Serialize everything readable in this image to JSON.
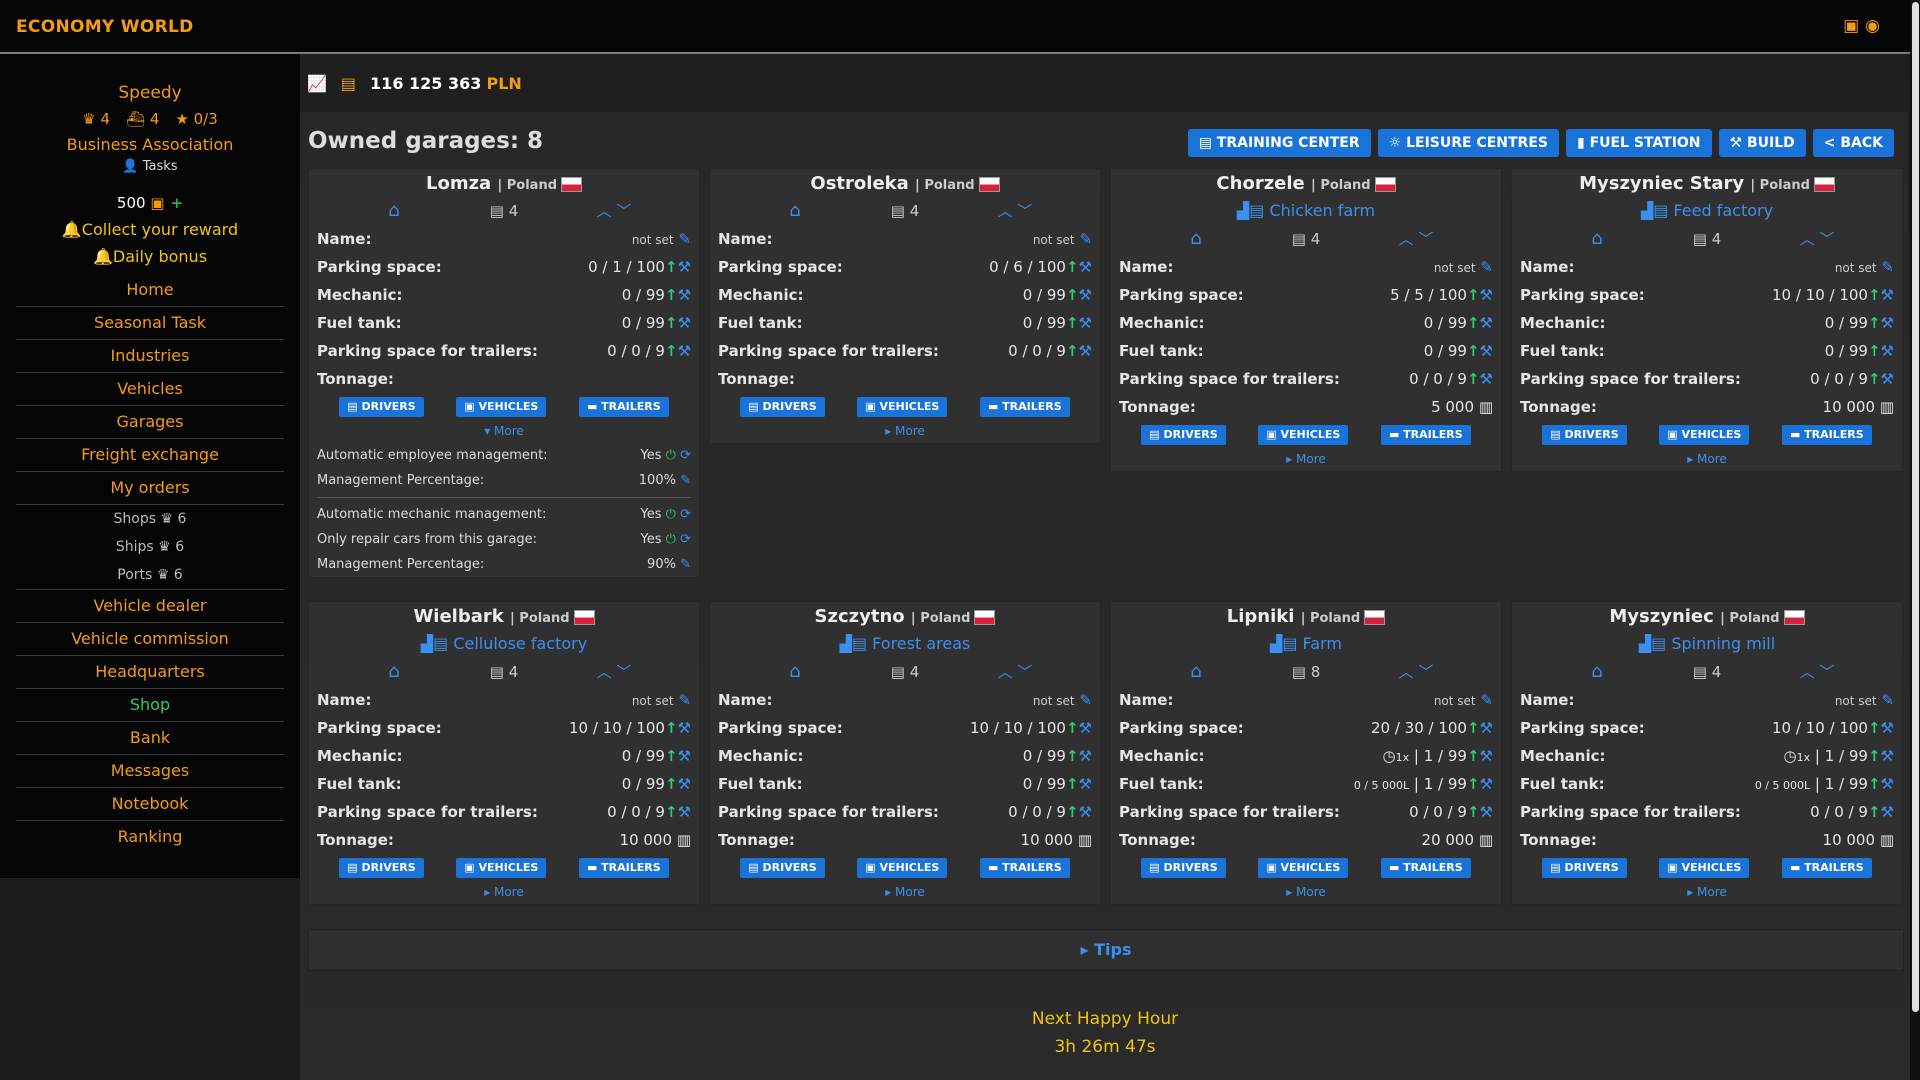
{
  "app_title": "ECONOMY WORLD",
  "sidebar": {
    "username": "Speedy",
    "stat1": "4",
    "stat2": "4",
    "stat3": "0/3",
    "association": "Business Association",
    "tasks": "Tasks",
    "coins": "500",
    "collect_reward": "Collect your reward",
    "daily_bonus": "Daily bonus",
    "nav": [
      "Home",
      "Seasonal Task",
      "Industries",
      "Vehicles",
      "Garages",
      "Freight exchange",
      "My orders"
    ],
    "nav_small": [
      {
        "label": "Shops",
        "count": "6"
      },
      {
        "label": "Ships",
        "count": "6"
      },
      {
        "label": "Ports",
        "count": "6"
      }
    ],
    "nav2": [
      "Vehicle dealer",
      "Vehicle commission",
      "Headquarters",
      "Shop",
      "Bank",
      "Messages",
      "Notebook",
      "Ranking"
    ]
  },
  "balance": {
    "amount": "116 125 363",
    "currency": "PLN"
  },
  "page_title": "Owned garages: 8",
  "top_buttons": [
    "TRAINING CENTER",
    "LEISURE CENTRES",
    "FUEL STATION",
    "BUILD",
    "< BACK"
  ],
  "labels": {
    "name": "Name:",
    "parking": "Parking space:",
    "mechanic": "Mechanic:",
    "fuel": "Fuel tank:",
    "trailers_space": "Parking space for trailers:",
    "tonnage": "Tonnage:",
    "not_set": "not set",
    "drivers": "DRIVERS",
    "vehicles": "VEHICLES",
    "trailers": "TRAILERS",
    "more": "More"
  },
  "garages": [
    {
      "city": "Lomza",
      "country": "| Poland",
      "industry": "",
      "count": "4",
      "parking": "0 / 1 / 100",
      "mechanic": "0 / 99",
      "fuel": "0 / 99",
      "trailers": "0 / 0 / 9",
      "tonnage": ""
    },
    {
      "city": "Ostroleka",
      "country": "| Poland",
      "industry": "",
      "count": "4",
      "parking": "0 / 6 / 100",
      "mechanic": "0 / 99",
      "fuel": "0 / 99",
      "trailers": "0 / 0 / 9",
      "tonnage": ""
    },
    {
      "city": "Chorzele",
      "country": "| Poland",
      "industry": "Chicken farm",
      "count": "4",
      "parking": "5 / 5 / 100",
      "mechanic": "0 / 99",
      "fuel": "0 / 99",
      "trailers": "0 / 0 / 9",
      "tonnage": "5 000"
    },
    {
      "city": "Myszyniec Stary",
      "country": "| Poland",
      "industry": "Feed factory",
      "count": "4",
      "parking": "10 / 10 / 100",
      "mechanic": "0 / 99",
      "fuel": "0 / 99",
      "trailers": "0 / 0 / 9",
      "tonnage": "10 000"
    },
    {
      "city": "Wielbark",
      "country": "| Poland",
      "industry": "Cellulose factory",
      "count": "4",
      "parking": "10 / 10 / 100",
      "mechanic": "0 / 99",
      "fuel": "0 / 99",
      "trailers": "0 / 0 / 9",
      "tonnage": "10 000"
    },
    {
      "city": "Szczytno",
      "country": "| Poland",
      "industry": "Forest areas",
      "count": "4",
      "parking": "10 / 10 / 100",
      "mechanic": "0 / 99",
      "fuel": "0 / 99",
      "trailers": "0 / 0 / 9",
      "tonnage": "10 000"
    },
    {
      "city": "Lipniki",
      "country": "| Poland",
      "industry": "Farm",
      "count": "8",
      "parking": "20 / 30 / 100",
      "mechanic_pre": "1x",
      "mechanic": "| 1 / 99",
      "fuel_pre": "0 / 5 000L",
      "fuel": "| 1 / 99",
      "trailers": "0 / 0 / 9",
      "tonnage": "20 000"
    },
    {
      "city": "Myszyniec",
      "country": "| Poland",
      "industry": "Spinning mill",
      "count": "4",
      "parking": "10 / 10 / 100",
      "mechanic_pre": "1x",
      "mechanic": "| 1 / 99",
      "fuel_pre": "0 / 5 000L",
      "fuel": "| 1 / 99",
      "trailers": "0 / 0 / 9",
      "tonnage": "10 000"
    }
  ],
  "lomza_extra": {
    "auto_emp": "Automatic employee management:",
    "auto_emp_val": "Yes",
    "mgmt_pct": "Management Percentage:",
    "mgmt_pct_val": "100%",
    "auto_mech": "Automatic mechanic management:",
    "auto_mech_val": "Yes",
    "only_repair": "Only repair cars from this garage:",
    "only_repair_val": "Yes",
    "mgmt_pct2": "Management Percentage:",
    "mgmt_pct2_val": "90%"
  },
  "tips": "Tips",
  "happy_hour": {
    "label": "Next Happy Hour",
    "time": "3h 26m 47s"
  }
}
